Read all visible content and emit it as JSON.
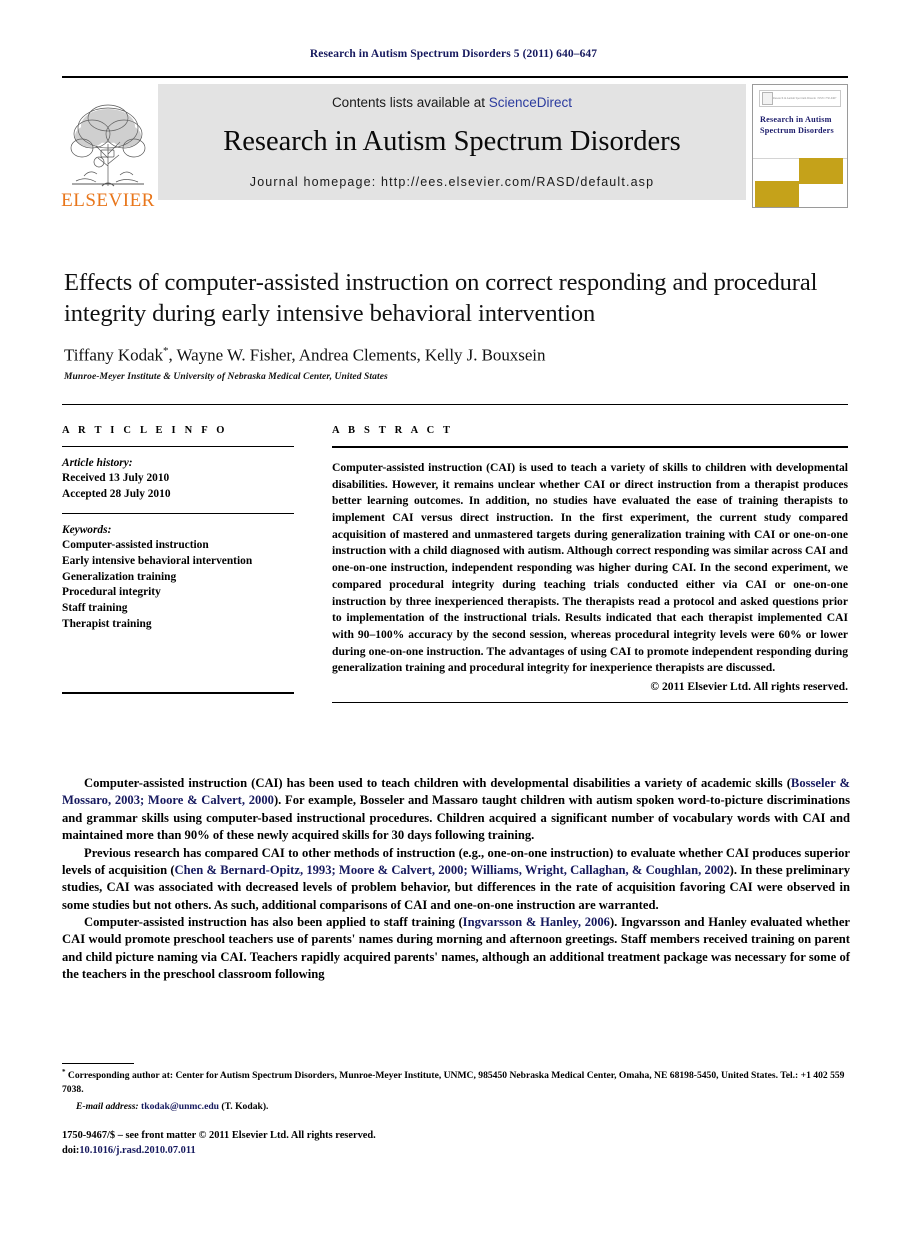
{
  "running_head": "Research in Autism Spectrum Disorders 5 (2011) 640–647",
  "masthead": {
    "publisher_name": "ELSEVIER",
    "contents_prefix": "Contents lists available at ",
    "contents_link": "ScienceDirect",
    "journal_title": "Research in Autism Spectrum Disorders",
    "homepage": "Journal homepage: http://ees.elsevier.com/RASD/default.asp",
    "cover": {
      "title": "Research in Autism Spectrum Disorders",
      "masthead_mini": "Research in Autism Spectrum Disorders",
      "volume_mini": "ISSN 1750-9467",
      "accent_color": "#c5a21a"
    },
    "link_color": "#2b3b9e",
    "box_color": "#e3e3e3",
    "elsevier_orange": "#e8761b"
  },
  "article": {
    "title": "Effects of computer-assisted instruction on correct responding and procedural integrity during early intensive behavioral intervention",
    "authors": "Tiffany Kodak",
    "authors_rest": ", Wayne W. Fisher, Andrea Clements, Kelly J. Bouxsein",
    "corresponding_marker": "*",
    "affiliation": "Munroe-Meyer Institute & University of Nebraska Medical Center, United States"
  },
  "article_info": {
    "heading": "A R T I C L E   I N F O",
    "history_label": "Article history:",
    "history": [
      "Received 13 July 2010",
      "Accepted 28 July 2010"
    ],
    "keywords_label": "Keywords:",
    "keywords": [
      "Computer-assisted instruction",
      "Early intensive behavioral intervention",
      "Generalization training",
      "Procedural integrity",
      "Staff training",
      "Therapist training"
    ]
  },
  "abstract": {
    "heading": "A B S T R A C T",
    "text": "Computer-assisted instruction (CAI) is used to teach a variety of skills to children with developmental disabilities. However, it remains unclear whether CAI or direct instruction from a therapist produces better learning outcomes. In addition, no studies have evaluated the ease of training therapists to implement CAI versus direct instruction. In the first experiment, the current study compared acquisition of mastered and unmastered targets during generalization training with CAI or one-on-one instruction with a child diagnosed with autism. Although correct responding was similar across CAI and one-on-one instruction, independent responding was higher during CAI. In the second experiment, we compared procedural integrity during teaching trials conducted either via CAI or one-on-one instruction by three inexperienced therapists. The therapists read a protocol and asked questions prior to implementation of the instructional trials. Results indicated that each therapist implemented CAI with 90–100% accuracy by the second session, whereas procedural integrity levels were 60% or lower during one-on-one instruction. The advantages of using CAI to promote independent responding during generalization training and procedural integrity for inexperience therapists are discussed.",
    "copyright": "© 2011 Elsevier Ltd. All rights reserved."
  },
  "body": {
    "paragraph_1_a": "Computer-assisted instruction (CAI) has been used to teach children with developmental disabilities a variety of academic skills (",
    "paragraph_1_cite": "Bosseler & Mossaro, 2003; Moore & Calvert, 2000",
    "paragraph_1_b": "). For example, Bosseler and Massaro taught children with autism spoken word-to-picture discriminations and grammar skills using computer-based instructional procedures. Children acquired a significant number of vocabulary words with CAI and maintained more than 90% of these newly acquired skills for 30 days following training.",
    "paragraph_2_a": "Previous research has compared CAI to other methods of instruction (e.g., one-on-one instruction) to evaluate whether CAI produces superior levels of acquisition (",
    "paragraph_2_cite": "Chen & Bernard-Opitz, 1993; Moore & Calvert, 2000; Williams, Wright, Callaghan, & Coughlan, 2002",
    "paragraph_2_b": "). In these preliminary studies, CAI was associated with decreased levels of problem behavior, but differences in the rate of acquisition favoring CAI were observed in some studies but not others. As such, additional comparisons of CAI and one-on-one instruction are warranted.",
    "paragraph_3_a": "Computer-assisted instruction has also been applied to staff training (",
    "paragraph_3_cite": "Ingvarsson & Hanley, 2006",
    "paragraph_3_b": "). Ingvarsson and Hanley evaluated whether CAI would promote preschool teachers use of parents' names during morning and afternoon greetings. Staff members received training on parent and child picture naming via CAI. Teachers rapidly acquired parents' names, although an additional treatment package was necessary for some of the teachers in the preschool classroom following"
  },
  "footnote": {
    "marker": "*",
    "text": "Corresponding author at: Center for Autism Spectrum Disorders, Munroe-Meyer Institute, UNMC, 985450 Nebraska Medical Center, Omaha, NE 68198-5450, United States. Tel.: +1 402 559 7038.",
    "email_label": "E-mail address:",
    "email": "tkodak@unmc.edu",
    "email_suffix": "(T. Kodak)."
  },
  "colophon": {
    "line1": "1750-9467/$ – see front matter © 2011 Elsevier Ltd. All rights reserved.",
    "doi_label": "doi:",
    "doi": "10.1016/j.rasd.2010.07.011"
  }
}
